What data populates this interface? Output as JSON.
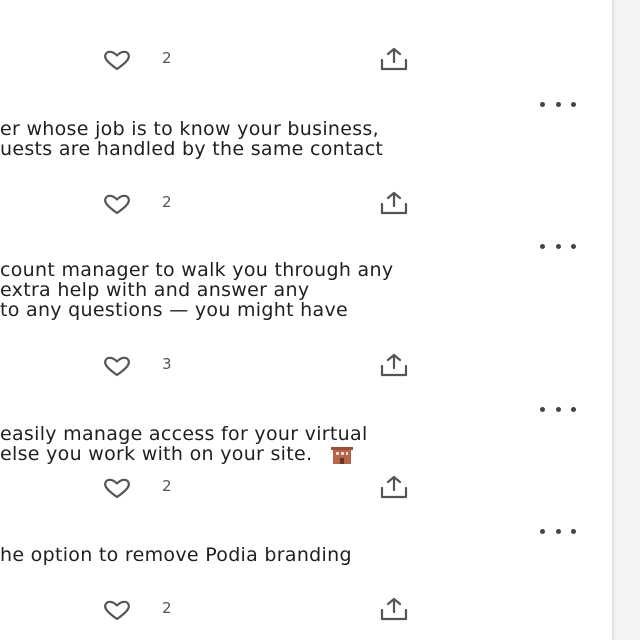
{
  "posts": [
    {
      "likes": "2"
    },
    {
      "lines": [
        "er whose job is to know your business,",
        "uests are handled by the same contact"
      ],
      "likes": "2"
    },
    {
      "lines": [
        "count manager to walk you through any",
        "extra help with and answer any",
        "to any questions — you might have"
      ],
      "likes": "3"
    },
    {
      "lines": [
        "easily manage access for your virtual",
        "else you work with on your site."
      ],
      "likes": "2"
    },
    {
      "lines": [
        "he option to remove Podia branding"
      ],
      "likes": "2"
    }
  ],
  "icons": {
    "like": "heart-icon",
    "share": "share-icon",
    "more": "more-options-icon",
    "emoji": "office-building-emoji"
  },
  "colors": {
    "text": "#1f1f1f",
    "icon": "#555555",
    "emoji": "#b5654a"
  }
}
